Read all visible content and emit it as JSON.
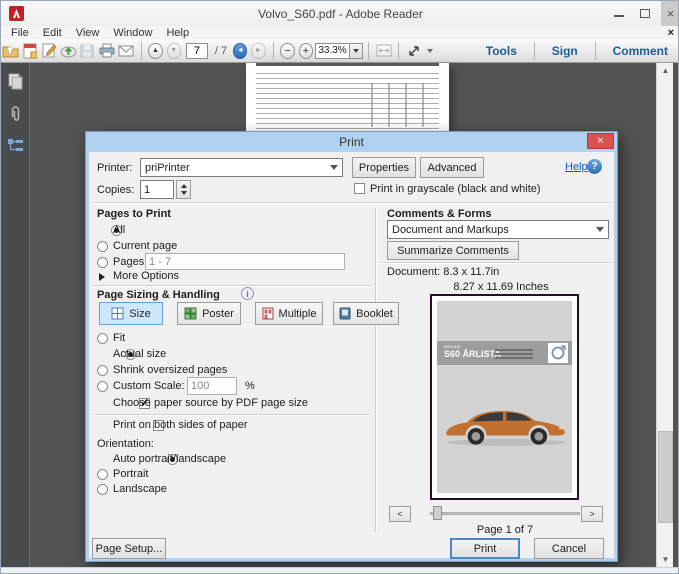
{
  "window": {
    "title": "Volvo_S60.pdf - Adobe Reader",
    "controls": {
      "minimize": "–",
      "maximize": "",
      "close": "×",
      "menubar_close": "×"
    }
  },
  "menu": {
    "items": [
      {
        "label": "File"
      },
      {
        "label": "Edit"
      },
      {
        "label": "View"
      },
      {
        "label": "Window"
      },
      {
        "label": "Help"
      }
    ]
  },
  "toolbar": {
    "page_value": "7",
    "page_total": "/ 7",
    "zoom_value": "33.3%",
    "tools": "Tools",
    "sign": "Sign",
    "comment": "Comment"
  },
  "dialog": {
    "title": "Print",
    "printer_label": "Printer:",
    "printer_value": "priPrinter",
    "properties": "Properties",
    "advanced": "Advanced",
    "help": "Help",
    "help_q": "?",
    "copies_label": "Copies:",
    "copies_value": "1",
    "grayscale": "Print in grayscale (black and white)",
    "pages_heading": "Pages to Print",
    "opt_all": "All",
    "opt_current": "Current page",
    "opt_pages": "Pages",
    "pages_range": "1 - 7",
    "more_options": "More Options",
    "sizing_heading": "Page Sizing & Handling",
    "info_i": "i",
    "btn_size": "Size",
    "btn_poster": "Poster",
    "btn_multiple": "Multiple",
    "btn_booklet": "Booklet",
    "opt_fit": "Fit",
    "opt_actual": "Actual size",
    "opt_shrink": "Shrink oversized pages",
    "opt_custom": "Custom Scale:",
    "custom_value": "100",
    "percent": "%",
    "paper_source": "Choose paper source by PDF page size",
    "duplex": "Print on both sides of paper",
    "orientation_heading": "Orientation:",
    "opt_auto": "Auto portrait/landscape",
    "opt_portrait": "Portrait",
    "opt_landscape": "Landscape",
    "comments_heading": "Comments & Forms",
    "comments_value": "Document and Markups",
    "summarize": "Summarize Comments",
    "doc_info": "Document: 8.3 x 11.7in",
    "size_info": "8.27 x 11.69 Inches",
    "page_info": "Page 1 of 7",
    "prev": "<",
    "next": ">",
    "page_setup": "Page Setup...",
    "print": "Print",
    "cancel": "Cancel"
  },
  "preview": {
    "brand": "VOLVO",
    "model": "S60 ÅRLISTA"
  },
  "colors": {
    "dialog_frame_blue": "#b1d1f0",
    "close_red": "#d9534c",
    "toolbar_link_blue": "#1d5c99",
    "selected_tab_bg": "#cfe7fb",
    "selected_tab_border": "#66a1dd",
    "document_bg": "#535353",
    "car_orange": "#c2702f",
    "preview_border": "#2b0b2b"
  }
}
